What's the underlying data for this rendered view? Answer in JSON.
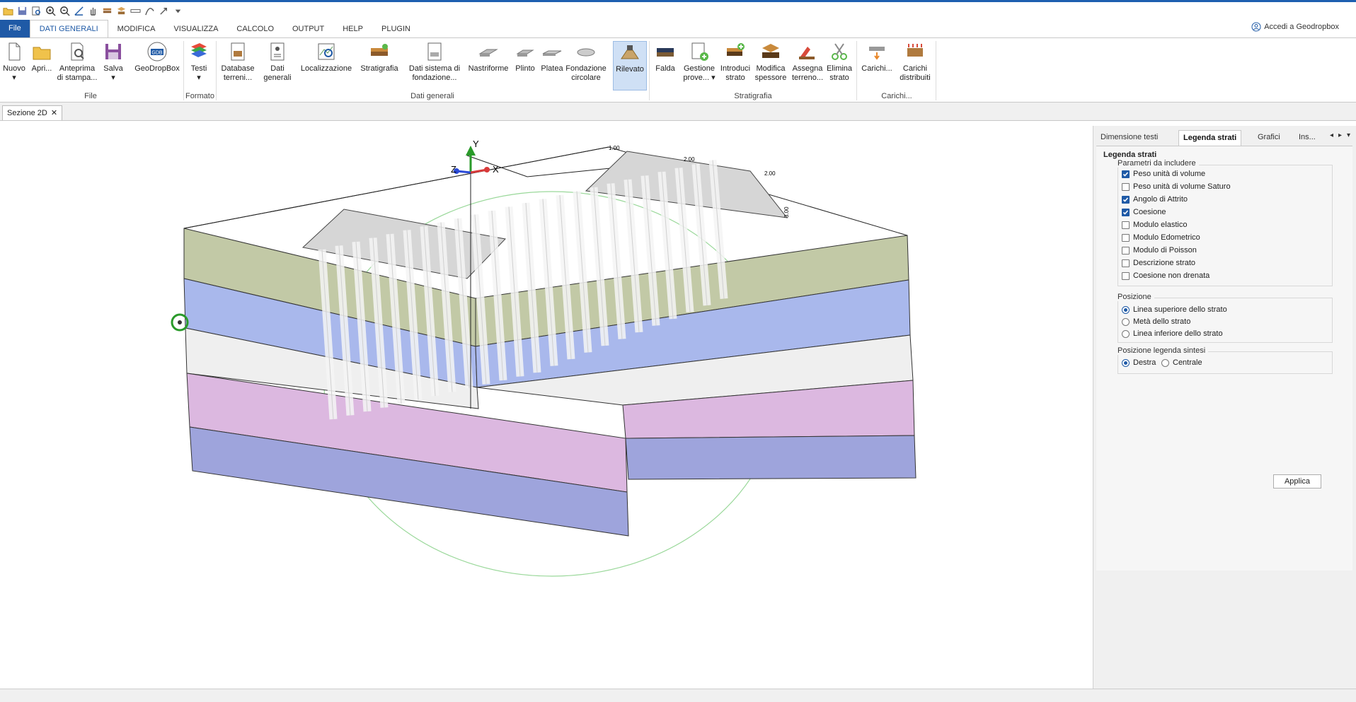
{
  "quick_access": {
    "icons": [
      "open-folder-icon",
      "save-icon",
      "print-preview-icon",
      "zoom-in-icon",
      "zoom-out-icon",
      "measure-icon",
      "edit-icon",
      "layers-icon",
      "pan-icon",
      "layers2-icon",
      "ruler-icon",
      "curve-icon",
      "arrow-icon",
      "dropdown-icon"
    ]
  },
  "menu": {
    "tabs": [
      {
        "id": "file",
        "label": "File"
      },
      {
        "id": "dati-generali",
        "label": "DATI GENERALI"
      },
      {
        "id": "modifica",
        "label": "MODIFICA"
      },
      {
        "id": "visualizza",
        "label": "VISUALIZZA"
      },
      {
        "id": "calcolo",
        "label": "CALCOLO"
      },
      {
        "id": "output",
        "label": "OUTPUT"
      },
      {
        "id": "help",
        "label": "HELP"
      },
      {
        "id": "plugin",
        "label": "PLUGIN"
      }
    ],
    "account_label": "Accedi a Geodropbox"
  },
  "ribbon": {
    "nuovo": {
      "l1": "Nuovo",
      "l2": "▾"
    },
    "apri": {
      "l1": "Apri..."
    },
    "anteprima": {
      "l1": "Anteprima",
      "l2": "di stampa..."
    },
    "salva": {
      "l1": "Salva",
      "l2": "▾"
    },
    "geodropbox": {
      "l1": "GeoDropBox",
      "logo": "GDB"
    },
    "testi": {
      "l1": "Testi",
      "l2": "▾"
    },
    "database": {
      "l1": "Database",
      "l2": "terreni..."
    },
    "dati": {
      "l1": "Dati",
      "l2": "generali"
    },
    "localizzazione": {
      "l1": "Localizzazione"
    },
    "stratigrafia": {
      "l1": "Stratigrafia"
    },
    "dati_sistema": {
      "l1": "Dati sistema di",
      "l2": "fondazione..."
    },
    "nastriforme": {
      "l1": "Nastriforme"
    },
    "plinto": {
      "l1": "Plinto"
    },
    "platea": {
      "l1": "Platea"
    },
    "fondazione": {
      "l1": "Fondazione",
      "l2": "circolare"
    },
    "rilevato": {
      "l1": "Rilevato"
    },
    "falda": {
      "l1": "Falda"
    },
    "gestione": {
      "l1": "Gestione",
      "l2": "prove... ▾"
    },
    "introduci": {
      "l1": "Introduci",
      "l2": "strato"
    },
    "modifica_sp": {
      "l1": "Modifica",
      "l2": "spessore"
    },
    "assegna": {
      "l1": "Assegna",
      "l2": "terreno..."
    },
    "elimina": {
      "l1": "Elimina",
      "l2": "strato"
    },
    "carichi": {
      "l1": "Carichi..."
    },
    "carichi_distr": {
      "l1": "Carichi",
      "l2": "distribuiti"
    },
    "groups": {
      "file": "File",
      "formato": "Formato",
      "dati_generali": "Dati generali",
      "stratigrafia": "Stratigrafia",
      "carichi": "Carichi..."
    }
  },
  "document_tab": {
    "label": "Sezione 2D",
    "close": "✕"
  },
  "viewport": {
    "axis_x": "X",
    "axis_y": "Y",
    "axis_z": "Z",
    "layer_colors": {
      "layer1": "#c2c9a6",
      "layer2": "#a9b8ec",
      "layer3": "#efefef",
      "layer4": "#dcb8e0",
      "layer5": "#9ea4dc"
    },
    "dimension_labels": [
      "1.00",
      "2.00",
      "2.00",
      "3.00"
    ]
  },
  "panel": {
    "tabs": [
      {
        "id": "dimensione",
        "label": "Dimensione testi"
      },
      {
        "id": "legenda",
        "label": "Legenda strati"
      },
      {
        "id": "grafici",
        "label": "Grafici"
      },
      {
        "id": "ins",
        "label": "Ins..."
      }
    ],
    "nav": {
      "prev": "◂",
      "next": "▸",
      "menu": "▾"
    },
    "title": "Legenda strati",
    "params_label": "Parametri da includere",
    "params": [
      {
        "label": "Peso unità di volume",
        "checked": true
      },
      {
        "label": "Peso unità di volume Saturo",
        "checked": false
      },
      {
        "label": "Angolo di Attrito",
        "checked": true
      },
      {
        "label": "Coesione",
        "checked": true
      },
      {
        "label": "Modulo elastico",
        "checked": false
      },
      {
        "label": "Modulo Edometrico",
        "checked": false
      },
      {
        "label": "Modulo di Poisson",
        "checked": false
      },
      {
        "label": "Descrizione strato",
        "checked": false
      },
      {
        "label": "Coesione non drenata",
        "checked": false
      }
    ],
    "posizione_label": "Posizione",
    "posizione": [
      {
        "label": "Linea superiore dello strato",
        "selected": true
      },
      {
        "label": "Metà dello strato",
        "selected": false
      },
      {
        "label": "Linea inferiore dello strato",
        "selected": false
      }
    ],
    "sintesi_label": "Posizione legenda sintesi",
    "sintesi": [
      {
        "label": "Destra",
        "selected": true
      },
      {
        "label": "Centrale",
        "selected": false
      }
    ],
    "apply_label": "Applica"
  }
}
